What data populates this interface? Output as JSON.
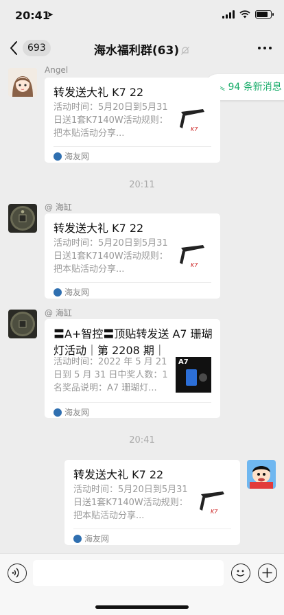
{
  "status_bar": {
    "time": "20:41"
  },
  "nav": {
    "back_count": "693",
    "title": "海水福利群(63)"
  },
  "new_messages": "94 条新消息",
  "timestamps": [
    "20:11",
    "20:41"
  ],
  "messages": [
    {
      "sender": "Angel",
      "card_title": "转发送大礼 K7 22",
      "card_desc": "活动时间：5月20日到5月31日送1套K7140W活动规则：把本贴活动分享...",
      "source": "海友网"
    },
    {
      "sender": "@ 海缸",
      "card_title": "转发送大礼 K7 22",
      "card_desc": "活动时间：5月20日到5月31日送1套K7140W活动规则：把本贴活动分享...",
      "source": "海友网"
    },
    {
      "sender": "@ 海缸",
      "card_title": "〓A+智控〓顶贴转发送 A7 珊瑚灯活动｜第 2208 期｜",
      "card_desc": "活动时间：2022 年 5 月 21 日到 5 月 31 日中奖人数：1 名奖品说明：A7 珊瑚灯...",
      "source": "海友网",
      "thumb_label": "A7"
    },
    {
      "sender": "",
      "card_title": "转发送大礼 K7 22",
      "card_desc": "活动时间：5月20日到5月31日送1套K7140W活动规则：把本贴活动分享...",
      "source": "海友网"
    }
  ],
  "colors": {
    "accent_green": "#1aad6b",
    "background": "#ededed"
  }
}
